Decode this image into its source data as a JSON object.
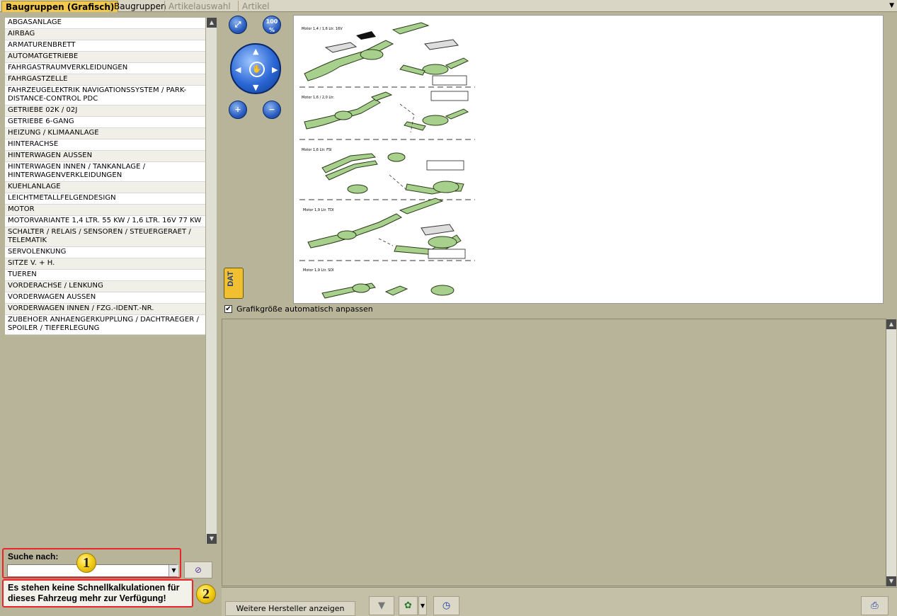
{
  "tabs": [
    {
      "label": "Baugruppen (Grafisch)",
      "state": "active"
    },
    {
      "label": "Baugruppen",
      "state": "normal"
    },
    {
      "label": "Artikelauswahl",
      "state": "disabled"
    },
    {
      "label": "Artikel",
      "state": "disabled"
    }
  ],
  "groups": [
    "ABGASANLAGE",
    "AIRBAG",
    "ARMATURENBRETT",
    "AUTOMATGETRIEBE",
    "FAHRGASTRAUMVERKLEIDUNGEN",
    "FAHRGASTZELLE",
    "FAHRZEUGELEKTRIK NAVIGATIONSSYSTEM / PARK-DISTANCE-CONTROL PDC",
    "GETRIEBE 02K / 02J",
    "GETRIEBE 6-GANG",
    "HEIZUNG / KLIMAANLAGE",
    "HINTERACHSE",
    "HINTERWAGEN AUSSEN",
    "HINTERWAGEN INNEN / TANKANLAGE / HINTERWAGENVERKLEIDUNGEN",
    "KUEHLANLAGE",
    "LEICHTMETALLFELGENDESIGN",
    "MOTOR",
    "MOTORVARIANTE 1,4 LTR. 55 KW / 1,6 LTR. 16V 77 KW",
    "SCHALTER / RELAIS / SENSOREN / STEUERGERAET / TELEMATIK",
    "SERVOLENKUNG",
    "SITZE V. + H.",
    "TUEREN",
    "VORDERACHSE / LENKUNG",
    "VORDERWAGEN AUSSEN",
    "VORDERWAGEN INNEN / FZG.-IDENT.-NR.",
    "ZUBEHOER ANHAENGERKUPPLUNG / DACHTRAEGER / SPOILER / TIEFERLEGUNG"
  ],
  "search": {
    "label": "Suche nach:",
    "value": ""
  },
  "badges": {
    "one": "1",
    "two": "2"
  },
  "notice": "Es stehen keine Schnellkalkulationen für dieses Fahrzeug mehr zur Verfügung!",
  "graphic": {
    "auto_fit_label": "Grafikgröße automatisch anpassen",
    "auto_fit_checked": true,
    "zoom_100_label": "100 %",
    "logo_text": "DAT",
    "section_labels": [
      "Motor 1,4 / 1,6 Ltr. 16V",
      "Motor 1,6 / 2,0 Ltr.",
      "Motor 1,6 Ltr. FSI",
      "Motor 1,9 Ltr. TDI",
      "Motor 1,9 Ltr. SDI"
    ]
  },
  "bottom": {
    "more_manufacturers": "Weitere Hersteller anzeigen"
  },
  "colors": {
    "accent_red": "#e8262a",
    "tab_active": "#f2c94c",
    "part_green": "#a8d08d",
    "panel_bg": "#b8b49a"
  }
}
